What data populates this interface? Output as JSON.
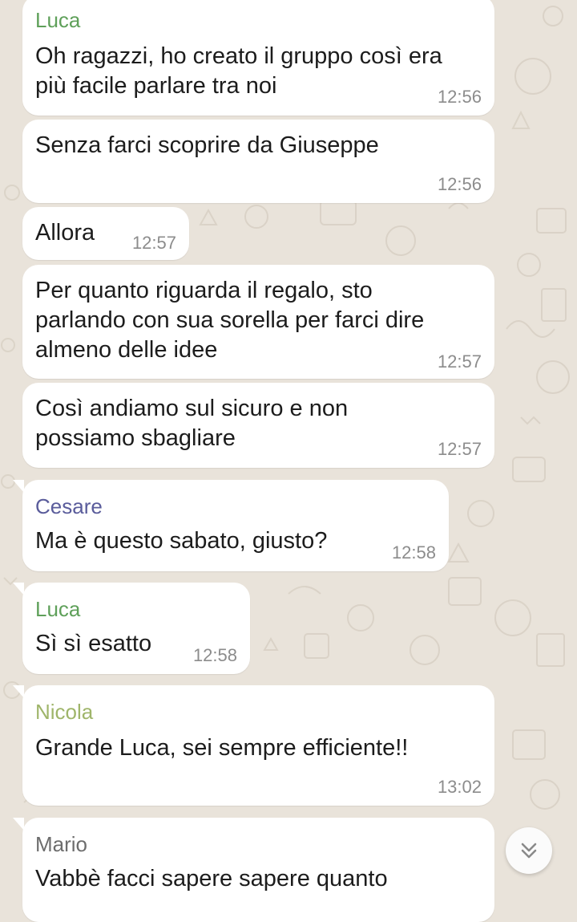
{
  "colors": {
    "wallpaper": "#e9e3da",
    "bubble": "#ffffff",
    "sender_luca": "#5fa05a",
    "sender_cesare": "#5a5c9b",
    "sender_nicola": "#9fb56a",
    "sender_mario": "#6d6d6d",
    "timestamp": "#8c8c8c"
  },
  "chat": {
    "messages": [
      {
        "sender": "Luca",
        "text": "Oh ragazzi, ho creato il gruppo così era\npiù facile parlare tra noi",
        "time": "12:56"
      },
      {
        "sender": "",
        "text": "Senza farci scoprire da Giuseppe",
        "time": "12:56"
      },
      {
        "sender": "",
        "text": "Allora",
        "time": "12:57"
      },
      {
        "sender": "",
        "text": "Per quanto riguarda il regalo, sto\nparlando con sua sorella per farci dire\nalmeno delle idee",
        "time": "12:57"
      },
      {
        "sender": "",
        "text": "Così andiamo sul sicuro e non\npossiamo sbagliare",
        "time": "12:57"
      },
      {
        "sender": "Cesare",
        "text": "Ma è questo sabato, giusto?",
        "time": "12:58"
      },
      {
        "sender": "Luca",
        "text": "Sì sì esatto",
        "time": "12:58"
      },
      {
        "sender": "Nicola",
        "text": "Grande Luca, sei sempre efficiente!!",
        "time": "13:02"
      },
      {
        "sender": "Mario",
        "text": "Vabbè facci sapere sapere quanto",
        "time": ""
      }
    ]
  },
  "scroll_button": {
    "icon": "double-chevron-down-icon"
  }
}
